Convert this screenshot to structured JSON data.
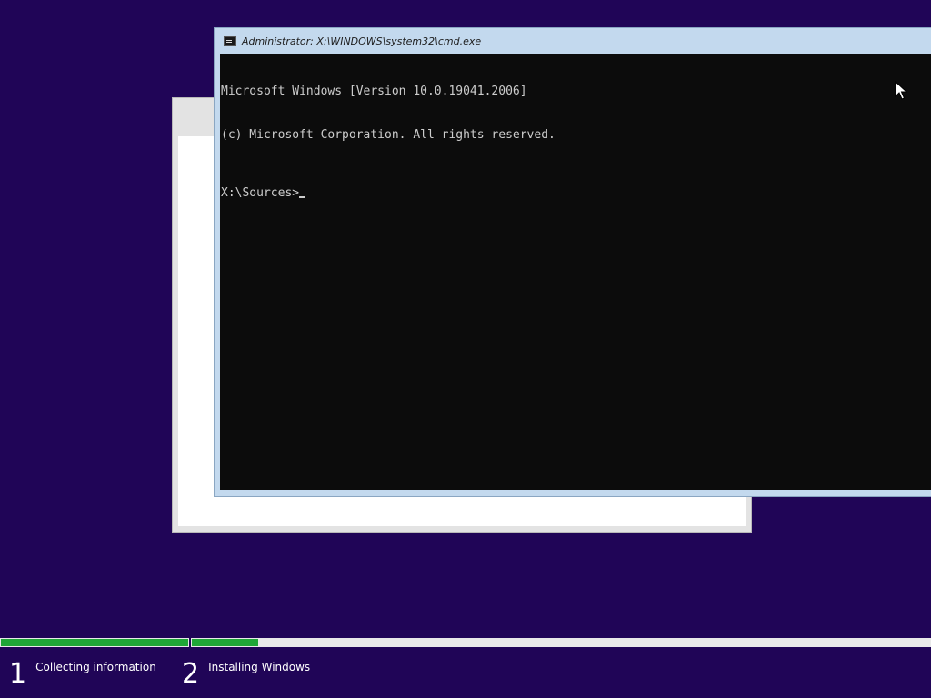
{
  "setup_window": {},
  "cmd": {
    "title": "Administrator: X:\\WINDOWS\\system32\\cmd.exe",
    "lines": [
      "Microsoft Windows [Version 10.0.19041.2006]",
      "(c) Microsoft Corporation. All rights reserved."
    ],
    "prompt": "X:\\Sources>",
    "icon": "cmd-icon"
  },
  "progress": {
    "steps": [
      {
        "number": "1",
        "label": "Collecting information",
        "progress": 1.0
      },
      {
        "number": "2",
        "label": "Installing Windows",
        "progress": 0.09
      }
    ],
    "fill_color": "#1fa637",
    "track_color": "#e9e9e9"
  },
  "colors": {
    "background": "#200557",
    "console_background": "#0c0c0c",
    "console_text": "#cccccc",
    "cmd_frame": "#c3d9ee"
  }
}
